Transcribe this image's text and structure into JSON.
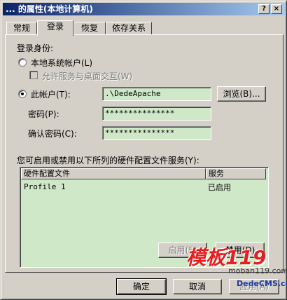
{
  "window": {
    "title": "... 的属性(本地计算机)",
    "help_label": "?",
    "close_label": "×"
  },
  "tabs": [
    {
      "label": "常规"
    },
    {
      "label": "登录"
    },
    {
      "label": "恢复"
    },
    {
      "label": "依存关系"
    }
  ],
  "login": {
    "section_label": "登录身份:",
    "local_system_label": "本地系统帐户(L)",
    "allow_desktop_label": "允许服务与桌面交互(W)",
    "this_account_label": "此帐户(T):",
    "account_value": ".\\DedeApache",
    "browse_label": "浏览(B)...",
    "password_label": "密码(P):",
    "password_value": "***************",
    "confirm_label": "确认密码(C):",
    "confirm_value": "***************"
  },
  "hardware": {
    "description": "您可启用或禁用以下所列的硬件配置文件服务(Y):",
    "columns": [
      "硬件配置文件",
      "服务"
    ],
    "rows": [
      {
        "profile": "Profile 1",
        "service": "已启用"
      }
    ],
    "enable_label": "启用(E)",
    "disable_label": "禁用(D)"
  },
  "footer": {
    "ok_label": "确定",
    "cancel_label": "取消",
    "apply_label": "应用(A)"
  },
  "watermark": {
    "logo": "模板119",
    "url1": "moban119.com",
    "url2": "DedeCMS.com"
  }
}
